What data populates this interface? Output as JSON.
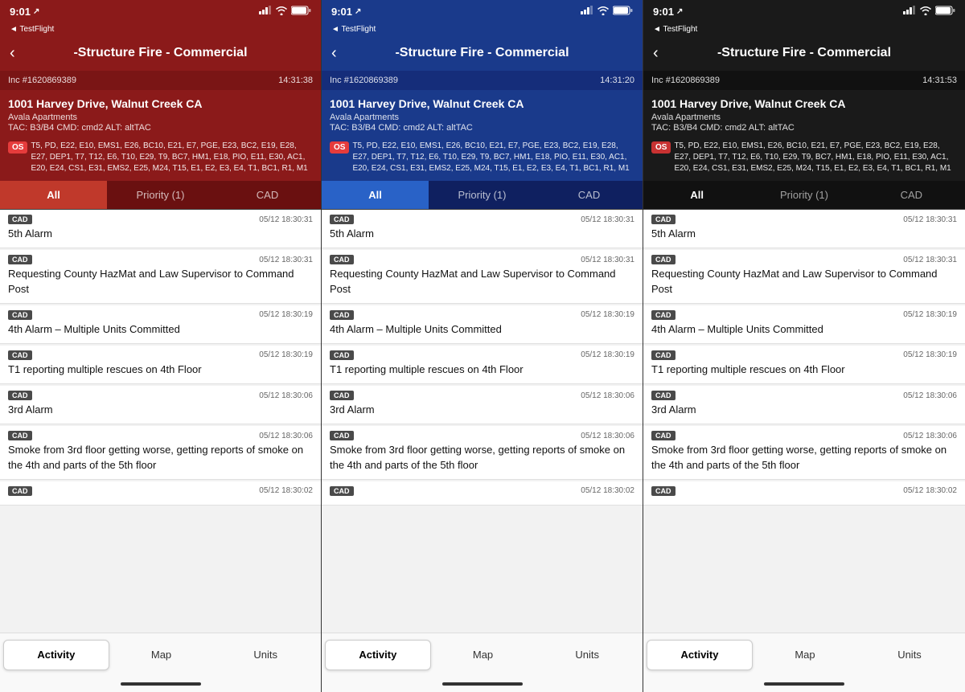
{
  "panels": [
    {
      "id": "panel-red",
      "theme": "red",
      "statusBar": {
        "time": "9:01",
        "arrow": "↗",
        "testflight": "◄ TestFlight"
      },
      "nav": {
        "backLabel": "‹",
        "title": "-Structure Fire - Commercial"
      },
      "incidentBar": {
        "incidentNum": "Inc #1620869389",
        "time": "14:31:38"
      },
      "address": {
        "street": "1001 Harvey Drive, Walnut Creek CA",
        "building": "Avala Apartments",
        "tac": "TAC: B3/B4 CMD: cmd2 ALT: altTAC"
      },
      "osBadge": "OS",
      "units": "T5, PD, E22, E10, EMS1, E26, BC10, E21, E7, PGE, E23, BC2, E19, E28, E27, DEP1, T7, T12, E6, T10, E29, T9, BC7, HM1, E18, PIO, E11, E30, AC1, E20, E24, CS1, E31, EMS2, E25, M24, T15, E1, E2, E3, E4, T1, BC1, R1, M1",
      "tabs": [
        {
          "label": "All",
          "active": true
        },
        {
          "label": "Priority (1)",
          "active": false
        },
        {
          "label": "CAD",
          "active": false
        }
      ],
      "activities": [
        {
          "badge": "CAD",
          "time": "05/12 18:30:31",
          "text": "5th Alarm"
        },
        {
          "badge": "CAD",
          "time": "05/12 18:30:31",
          "text": "Requesting County HazMat and Law Supervisor to Command Post"
        },
        {
          "badge": "CAD",
          "time": "05/12 18:30:19",
          "text": "4th Alarm – Multiple Units Committed"
        },
        {
          "badge": "CAD",
          "time": "05/12 18:30:19",
          "text": "T1 reporting multiple rescues on 4th Floor"
        },
        {
          "badge": "CAD",
          "time": "05/12 18:30:06",
          "text": "3rd Alarm"
        },
        {
          "badge": "CAD",
          "time": "05/12 18:30:06",
          "text": "Smoke from 3rd floor getting worse, getting reports of smoke on the 4th and parts of the 5th floor"
        },
        {
          "badge": "CAD",
          "time": "05/12 18:30:02",
          "text": ""
        }
      ],
      "bottomNav": [
        {
          "label": "Activity",
          "active": true
        },
        {
          "label": "Map",
          "active": false
        },
        {
          "label": "Units",
          "active": false
        }
      ]
    },
    {
      "id": "panel-blue",
      "theme": "blue",
      "statusBar": {
        "time": "9:01",
        "arrow": "↗",
        "testflight": "◄ TestFlight"
      },
      "nav": {
        "backLabel": "‹",
        "title": "-Structure Fire - Commercial"
      },
      "incidentBar": {
        "incidentNum": "Inc #1620869389",
        "time": "14:31:20"
      },
      "address": {
        "street": "1001 Harvey Drive, Walnut Creek CA",
        "building": "Avala Apartments",
        "tac": "TAC: B3/B4 CMD: cmd2 ALT: altTAC"
      },
      "osBadge": "OS",
      "units": "T5, PD, E22, E10, EMS1, E26, BC10, E21, E7, PGE, E23, BC2, E19, E28, E27, DEP1, T7, T12, E6, T10, E29, T9, BC7, HM1, E18, PIO, E11, E30, AC1, E20, E24, CS1, E31, EMS2, E25, M24, T15, E1, E2, E3, E4, T1, BC1, R1, M1",
      "tabs": [
        {
          "label": "All",
          "active": true
        },
        {
          "label": "Priority (1)",
          "active": false
        },
        {
          "label": "CAD",
          "active": false
        }
      ],
      "activities": [
        {
          "badge": "CAD",
          "time": "05/12 18:30:31",
          "text": "5th Alarm"
        },
        {
          "badge": "CAD",
          "time": "05/12 18:30:31",
          "text": "Requesting County HazMat and Law Supervisor to Command Post"
        },
        {
          "badge": "CAD",
          "time": "05/12 18:30:19",
          "text": "4th Alarm – Multiple Units Committed"
        },
        {
          "badge": "CAD",
          "time": "05/12 18:30:19",
          "text": "T1 reporting multiple rescues on 4th Floor"
        },
        {
          "badge": "CAD",
          "time": "05/12 18:30:06",
          "text": "3rd Alarm"
        },
        {
          "badge": "CAD",
          "time": "05/12 18:30:06",
          "text": "Smoke from 3rd floor getting worse, getting reports of smoke on the 4th and parts of the 5th floor"
        },
        {
          "badge": "CAD",
          "time": "05/12 18:30:02",
          "text": ""
        }
      ],
      "bottomNav": [
        {
          "label": "Activity",
          "active": true
        },
        {
          "label": "Map",
          "active": false
        },
        {
          "label": "Units",
          "active": false
        }
      ]
    },
    {
      "id": "panel-dark",
      "theme": "dark",
      "statusBar": {
        "time": "9:01",
        "arrow": "↗",
        "testflight": "◄ TestFlight"
      },
      "nav": {
        "backLabel": "‹",
        "title": "-Structure Fire - Commercial"
      },
      "incidentBar": {
        "incidentNum": "Inc #1620869389",
        "time": "14:31:53"
      },
      "address": {
        "street": "1001 Harvey Drive, Walnut Creek CA",
        "building": "Avala Apartments",
        "tac": "TAC: B3/B4 CMD: cmd2 ALT: altTAC"
      },
      "osBadge": "OS",
      "units": "T5, PD, E22, E10, EMS1, E26, BC10, E21, E7, PGE, E23, BC2, E19, E28, E27, DEP1, T7, T12, E6, T10, E29, T9, BC7, HM1, E18, PIO, E11, E30, AC1, E20, E24, CS1, E31, EMS2, E25, M24, T15, E1, E2, E3, E4, T1, BC1, R1, M1",
      "tabs": [
        {
          "label": "All",
          "active": true
        },
        {
          "label": "Priority (1)",
          "active": false
        },
        {
          "label": "CAD",
          "active": false
        }
      ],
      "activities": [
        {
          "badge": "CAD",
          "time": "05/12 18:30:31",
          "text": "5th Alarm"
        },
        {
          "badge": "CAD",
          "time": "05/12 18:30:31",
          "text": "Requesting County HazMat and Law Supervisor to Command Post"
        },
        {
          "badge": "CAD",
          "time": "05/12 18:30:19",
          "text": "4th Alarm – Multiple Units Committed"
        },
        {
          "badge": "CAD",
          "time": "05/12 18:30:19",
          "text": "T1 reporting multiple rescues on 4th Floor"
        },
        {
          "badge": "CAD",
          "time": "05/12 18:30:06",
          "text": "3rd Alarm"
        },
        {
          "badge": "CAD",
          "time": "05/12 18:30:06",
          "text": "Smoke from 3rd floor getting worse, getting reports of smoke on the 4th and parts of the 5th floor"
        },
        {
          "badge": "CAD",
          "time": "05/12 18:30:02",
          "text": ""
        }
      ],
      "bottomNav": [
        {
          "label": "Activity",
          "active": true
        },
        {
          "label": "Map",
          "active": false
        },
        {
          "label": "Units",
          "active": false
        }
      ]
    }
  ]
}
